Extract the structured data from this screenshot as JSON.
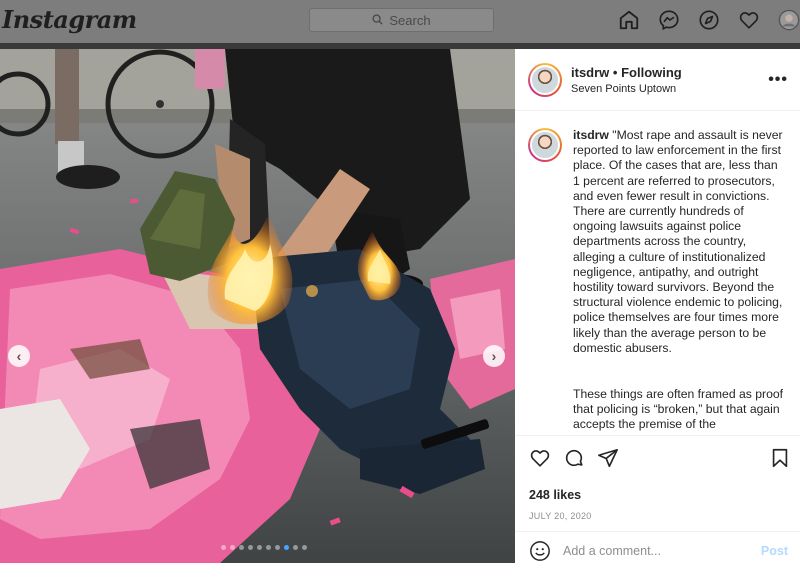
{
  "nav": {
    "logo": "Instagram",
    "search_placeholder": "Search",
    "icons": [
      "home-icon",
      "messenger-icon",
      "explore-icon",
      "heart-icon",
      "profile-avatar"
    ]
  },
  "post": {
    "username": "itsdrw",
    "following_label": "• Following",
    "location": "Seven Points Uptown",
    "more_label": "•••",
    "caption_part1": "\"Most rape and assault is never reported to law enforcement in the first place. Of the cases that are, less than 1 percent are referred to prosecutors, and even fewer result in convictions. There are currently hundreds of ongoing lawsuits against police departments across the country, alleging a culture of institutionalized negligence, antipathy, and outright hostility toward survivors. Beyond the structural violence endemic to policing, police themselves are four times more likely than the average person to be domestic abusers.",
    "caption_part2": "These things are often framed as proof that policing is “broken,” but that again accepts the premise of the",
    "likes": "248 likes",
    "date": "JULY 20, 2020",
    "comment_placeholder": "Add a comment...",
    "post_label": "Post"
  },
  "carousel": {
    "prev_label": "‹",
    "next_label": "›",
    "slide_count": 10,
    "active_index": 7
  },
  "colors": {
    "accent_link": "#b3dbff",
    "text": "#262626",
    "muted": "#8e8e8e"
  }
}
